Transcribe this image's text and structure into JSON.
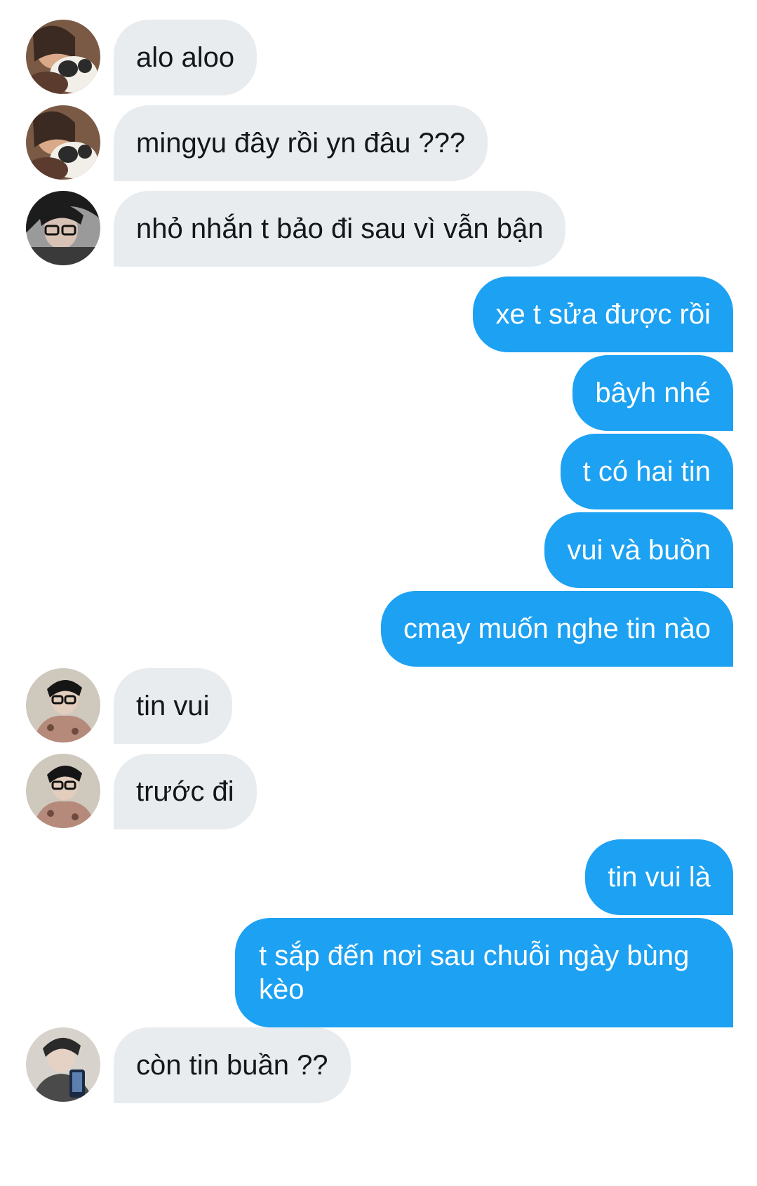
{
  "conversation": {
    "messages": [
      {
        "sender": "incoming",
        "avatar": "avatar-girl-with-cat-icon",
        "text": "alo aloo"
      },
      {
        "sender": "incoming",
        "avatar": "avatar-girl-with-cat-icon",
        "text": "mingyu đây rồi yn đâu ???"
      },
      {
        "sender": "incoming",
        "avatar": "avatar-person-with-glasses-icon",
        "text": "nhỏ nhắn t bảo đi sau vì vẫn bận"
      },
      {
        "sender": "outgoing",
        "text": "xe t sửa được rồi"
      },
      {
        "sender": "outgoing",
        "text": "bâyh nhé"
      },
      {
        "sender": "outgoing",
        "text": "t có hai tin"
      },
      {
        "sender": "outgoing",
        "text": "vui và buồn"
      },
      {
        "sender": "outgoing",
        "text": "cmay muốn nghe tin nào"
      },
      {
        "sender": "incoming",
        "avatar": "avatar-boy-with-glasses-icon",
        "text": "tin vui"
      },
      {
        "sender": "incoming",
        "avatar": "avatar-boy-with-glasses-icon",
        "text": "trước đi"
      },
      {
        "sender": "outgoing",
        "text": "tin vui là"
      },
      {
        "sender": "outgoing",
        "text": "t sắp đến nơi sau chuỗi ngày bùng kèo"
      },
      {
        "sender": "incoming",
        "avatar": "avatar-boy-with-phone-icon",
        "text": "còn tin buần ??"
      }
    ]
  },
  "colors": {
    "incoming_bubble": "#e9ecef",
    "outgoing_bubble": "#1da1f2",
    "incoming_text": "#14171a",
    "outgoing_text": "#ffffff",
    "background": "#ffffff"
  }
}
